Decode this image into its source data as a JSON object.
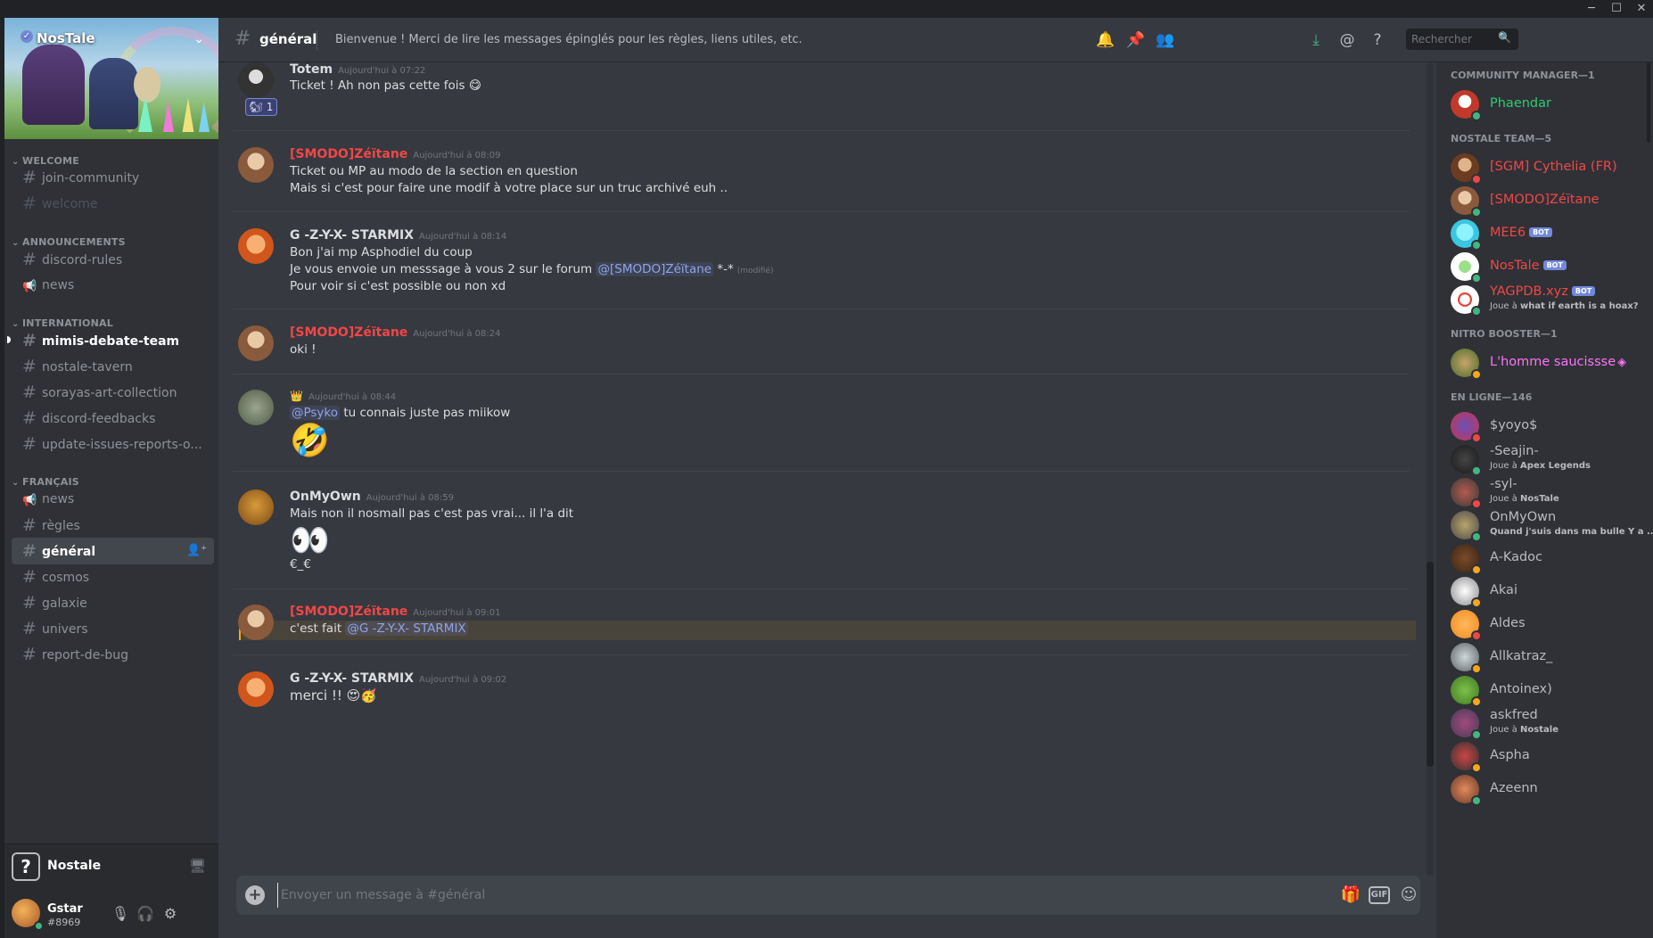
{
  "window": {
    "minimize": "─",
    "maximize": "☐",
    "close": "✕"
  },
  "server": {
    "name": "NosTale",
    "verified_icon": "✓",
    "dropdown_icon": "⌄",
    "footer_name": "Nostale",
    "footer_icon": "?"
  },
  "sidebar": {
    "categories": [
      {
        "label": "WELCOME",
        "channels": [
          {
            "name": "join-community",
            "icon": "#",
            "state": "normal"
          },
          {
            "name": "welcome",
            "icon": "#",
            "state": "muted"
          }
        ]
      },
      {
        "label": "ANNOUNCEMENTS",
        "channels": [
          {
            "name": "discord-rules",
            "icon": "#",
            "state": "normal"
          },
          {
            "name": "news",
            "icon": "📢",
            "state": "normal"
          }
        ]
      },
      {
        "label": "INTERNATIONAL",
        "channels": [
          {
            "name": "mimis-debate-team",
            "icon": "#",
            "state": "unread"
          },
          {
            "name": "nostale-tavern",
            "icon": "#",
            "state": "normal"
          },
          {
            "name": "sorayas-art-collection",
            "icon": "#",
            "state": "normal"
          },
          {
            "name": "discord-feedbacks",
            "icon": "#",
            "state": "normal"
          },
          {
            "name": "update-issues-reports-o...",
            "icon": "#",
            "state": "normal"
          }
        ]
      },
      {
        "label": "FRANÇAIS",
        "channels": [
          {
            "name": "news",
            "icon": "📢",
            "state": "normal"
          },
          {
            "name": "règles",
            "icon": "#",
            "state": "normal"
          },
          {
            "name": "général",
            "icon": "#",
            "state": "active"
          },
          {
            "name": "cosmos",
            "icon": "#",
            "state": "normal"
          },
          {
            "name": "galaxie",
            "icon": "#",
            "state": "normal"
          },
          {
            "name": "univers",
            "icon": "#",
            "state": "normal"
          },
          {
            "name": "report-de-bug",
            "icon": "#",
            "state": "normal"
          }
        ]
      }
    ]
  },
  "user": {
    "name": "Gstar",
    "tag": "#8969",
    "status_color": "#43b581"
  },
  "header": {
    "channel": "général",
    "topic": "Bienvenue ! Merci de lire les messages épinglés pour les règles, liens utiles, etc.",
    "search_placeholder": "Rechercher"
  },
  "messages": [
    {
      "author": "Totem",
      "color": "#ffffff",
      "timestamp": "Aujourd'hui à 07:22",
      "lines": [
        "Ticket ! Ah non pas cette fois 😋"
      ],
      "reaction": {
        "emoji": "🐿",
        "count": "1"
      }
    },
    {
      "author": "[SMODO]Zéïtane",
      "color": "#f04747",
      "timestamp": "Aujourd'hui à 08:09",
      "lines": [
        "Ticket ou MP au modo de la section en question",
        "Mais si c'est pour faire une modif à votre place sur un truc archivé euh .."
      ]
    },
    {
      "author": "G -Z-Y-X- STARMIX",
      "color": "#ffffff",
      "timestamp": "Aujourd'hui à 08:14",
      "lines": [
        "Bon j'ai mp Asphodiel du coup"
      ],
      "line2_pre": "Je vous envoie un messsage à vous 2 sur le forum ",
      "line2_mention": "@[SMODO]Zéïtane",
      "line2_post": " *-*",
      "edited": "(modifié)",
      "line3": "Pour voir si c'est possible ou non xd"
    },
    {
      "author": "[SMODO]Zéïtane",
      "color": "#f04747",
      "timestamp": "Aujourd'hui à 08:24",
      "lines": [
        "oki !"
      ]
    },
    {
      "author": "👑",
      "color": "#ffffff",
      "timestamp": "Aujourd'hui à 08:44",
      "mention": "@Psyko",
      "text": " tu connais juste pas miikow",
      "big_emoji": "🤣"
    },
    {
      "author": "OnMyOwn",
      "color": "#ffffff",
      "timestamp": "Aujourd'hui à 08:59",
      "lines": [
        "Mais non il nosmall pas c'est pas vrai... il l'a dit"
      ],
      "big_emoji": "👀",
      "after": "€_€"
    },
    {
      "author": "[SMODO]Zéïtane",
      "color": "#f04747",
      "timestamp": "Aujourd'hui à 09:01",
      "text": "c'est fait ",
      "mention": "@G -Z-Y-X- STARMIX"
    },
    {
      "author": "G -Z-Y-X- STARMIX",
      "color": "#ffffff",
      "timestamp": "Aujourd'hui à 09:02",
      "lines": [
        "merci !! 😍🥳"
      ]
    }
  ],
  "composer": {
    "placeholder": "Envoyer un message à #général",
    "gif_label": "GIF"
  },
  "members": {
    "groups": [
      {
        "label": "COMMUNITY MANAGER—1",
        "items": [
          {
            "name": "Phaendar",
            "color": "#2ecc71",
            "status": "#43b581"
          }
        ]
      },
      {
        "label": "NOSTALE TEAM—5",
        "items": [
          {
            "name": "[SGM] Cythelia (FR)",
            "color": "#f04747",
            "status": "#f04747"
          },
          {
            "name": "[SMODO]Zéïtane",
            "color": "#f04747",
            "status": "#43b581"
          },
          {
            "name": "MEE6",
            "color": "#f04747",
            "status": "#43b581",
            "bot": "BOT"
          },
          {
            "name": "NosTale",
            "color": "#f04747",
            "status": "#43b581",
            "bot": "BOT"
          },
          {
            "name": "YAGPDB.xyz",
            "color": "#f04747",
            "status": "#43b581",
            "bot": "BOT",
            "activity_pre": "Joue à ",
            "activity": "what if earth is a hoax?"
          }
        ]
      },
      {
        "label": "NITRO BOOSTER—1",
        "items": [
          {
            "name": "L'homme saucissse",
            "color": "#ff73fa",
            "status": "#faa61a",
            "boost": "◈"
          }
        ]
      },
      {
        "label": "EN LIGNE—146",
        "items": [
          {
            "name": "$yoyo$",
            "color": "#b9bbbe",
            "status": "#f04747"
          },
          {
            "name": "-Seajin-",
            "color": "#b9bbbe",
            "status": "#43b581",
            "activity_pre": "Joue à ",
            "activity": "Apex Legends"
          },
          {
            "name": "-syl-",
            "color": "#b9bbbe",
            "status": "#f04747",
            "activity_pre": "Joue à ",
            "activity": "NosTale"
          },
          {
            "name": "OnMyOwn",
            "color": "#b9bbbe",
            "status": "#43b581",
            "activity_pre": "",
            "activity": "Quand j'suis dans ma bulle Y a ..."
          },
          {
            "name": "A-Kadoc",
            "color": "#b9bbbe",
            "status": "#faa61a"
          },
          {
            "name": "Akai",
            "color": "#b9bbbe",
            "status": "#faa61a"
          },
          {
            "name": "Aldes",
            "color": "#b9bbbe",
            "status": "#f04747"
          },
          {
            "name": "Allkatraz_",
            "color": "#b9bbbe",
            "status": "#faa61a"
          },
          {
            "name": "Antoinex)",
            "color": "#b9bbbe",
            "status": "#faa61a"
          },
          {
            "name": "askfred",
            "color": "#b9bbbe",
            "status": "#43b581",
            "activity_pre": "Joue à ",
            "activity": "Nostale"
          },
          {
            "name": "Aspha",
            "color": "#b9bbbe",
            "status": "#faa61a"
          },
          {
            "name": "Azeenn",
            "color": "#b9bbbe",
            "status": "#43b581"
          }
        ]
      }
    ]
  }
}
